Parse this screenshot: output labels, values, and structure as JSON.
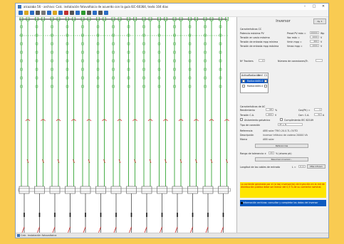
{
  "window": {
    "title": "alcazaba 56 - archivo: Calc. instalación fotovoltaica de acuerdo con la guía IEC-60364, texto 104 dias",
    "controls": [
      "minimize-icon",
      "maximize-icon",
      "close-icon"
    ]
  },
  "toolbar": {
    "icons": [
      "new-icon",
      "open-icon",
      "save-icon",
      "print-icon",
      "preview-icon",
      "copy-icon",
      "paste-icon",
      "undo-icon",
      "pencil-icon",
      "wrench-icon",
      "sum-icon",
      "chart-icon",
      "grid-icon",
      "search-icon",
      "gear-icon",
      "help-icon"
    ]
  },
  "diagram": {
    "string_count": 14,
    "line_color": "#1a9a1a",
    "fault_color": "#d02020",
    "module_color": "#1a9a1a"
  },
  "panel": {
    "title": "Inversor",
    "help_label": "Ay. 1",
    "dc_heading": "Características CC",
    "dc_rows": [
      {
        "label": "Potencia máxima PV",
        "sub": "Pmod PV máx =",
        "value": "20000",
        "unit": "Wp"
      },
      {
        "label": "Tensión en vacío máxima",
        "sub": "Voc máx =",
        "value": "1000",
        "unit": "V"
      },
      {
        "label": "Tensión de entrada mpp mínima",
        "sub": "Vmin mpp =",
        "value": "460",
        "unit": "V"
      },
      {
        "label": "Tensión de entrada mpp máxima",
        "sub": "Vmax mpp =",
        "value": "1000",
        "unit": "V"
      }
    ],
    "trackers_label": "Nº Trackers",
    "trackers_value": "2",
    "connections_label": "Número de conexiones/Tr.",
    "connections_value": "",
    "grid_headers": [
      "Activo",
      "Radiación",
      "Vmf",
      "C1"
    ],
    "grid_rows": [
      {
        "radiation": "Radiación",
        "value": "20.0",
        "selected": true
      },
      {
        "radiation": "Radiación",
        "value": "20.0",
        "selected": false
      }
    ],
    "ac_heading": "Características de AC",
    "ac_rows": [
      {
        "label": "Rendimiento",
        "value": "98",
        "unit": "%",
        "sub": "Cos(Ph) =",
        "subvalue": "1"
      },
      {
        "label": "Tensión C.A.",
        "value": "400",
        "unit": "V",
        "sub": "Corr. C.A.",
        "subvalue": "32",
        "subunit": "A"
      }
    ],
    "galvanic_label": "Aislamiento galvánico",
    "iec_label": "Cumplimiento IEC 62109",
    "connection_type_label": "Tipo de conexión",
    "connection_type_value": "3F + N",
    "reference_label": "Referencia",
    "reference_value": "ABB solar TRIO-20.0-TL-OUTD",
    "description_label": "Descripción",
    "description_value": "inversor trifásico de cadena 20000 VA",
    "brand_label": "Marca",
    "brand_value": "ABB solar",
    "reference_button": "Referencias",
    "tolerance_label": "Rango de tolerancia ±",
    "tolerance_value": "20",
    "tolerance_unit": "% (ahorro pk)",
    "summary_button": "Resumen inversor...",
    "cable_label": "Longitud de los cables de entrada",
    "cable_value": "L =",
    "cable_unit": "0 m",
    "cable_button": "Más info/en",
    "warning_text": "La corriente generada por el (o los) inversor(es) de inyección en la red de distribución pública debe ser menor del 0,5 % de su corriente nominal.",
    "info_text": "Información archivos: consultar y completar los datos del inversor"
  },
  "statusbar": {
    "text": "Calc. instalación fotovoltaica"
  }
}
